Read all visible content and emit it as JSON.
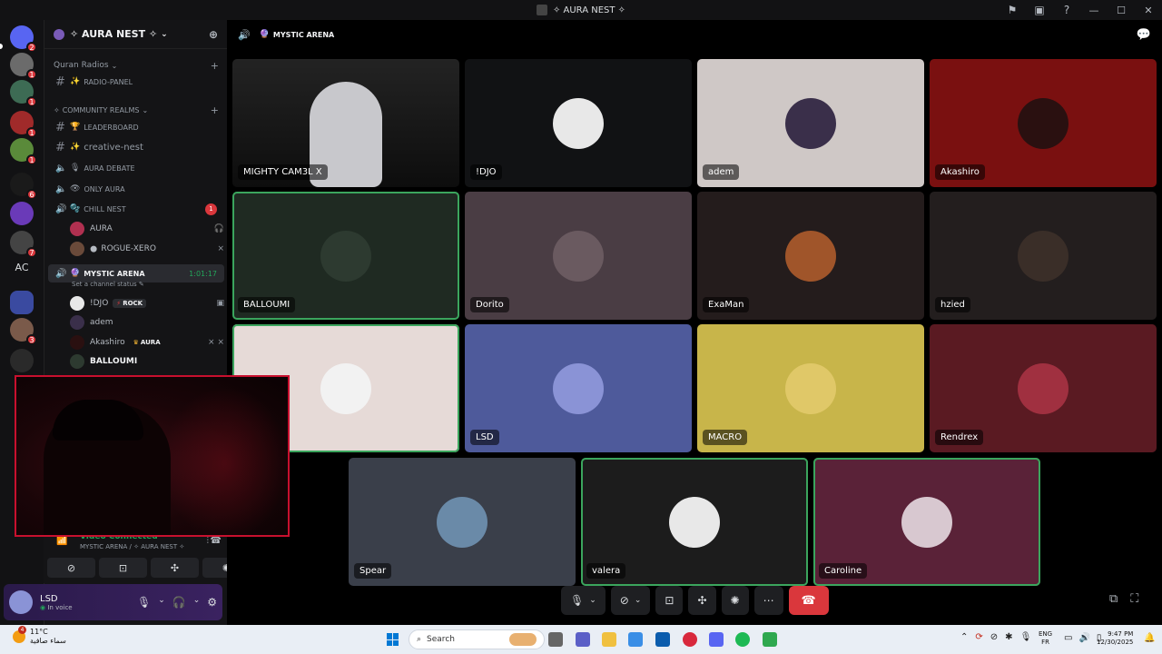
{
  "window": {
    "title": "✧ AURA NEST ✧"
  },
  "rail": {
    "servers": [
      {
        "name": "discord-home",
        "badge": "2",
        "color": "#5865f2"
      },
      {
        "name": "server-1",
        "badge": "1",
        "color": "#6b6b6b"
      },
      {
        "name": "server-2",
        "badge": "1",
        "color": "#3d6b54"
      },
      {
        "name": "server-3",
        "badge": "1",
        "color": "#a02a2a"
      },
      {
        "name": "server-4",
        "badge": "1",
        "color": "#5a8a3a"
      },
      {
        "name": "server-5",
        "badge": "6",
        "color": "#1a1a1a"
      },
      {
        "name": "server-6",
        "badge": "",
        "color": "#6a3ab8"
      },
      {
        "name": "server-7",
        "badge": "7",
        "color": "#444"
      },
      {
        "name": "server-folder",
        "badge": "",
        "color": "#3a4aa0"
      },
      {
        "name": "server-8",
        "badge": "3",
        "color": "#7a5a4a"
      },
      {
        "name": "server-9",
        "badge": "",
        "color": "#2a2a2a"
      }
    ],
    "ac_label": "AC"
  },
  "sidebar": {
    "server_name": "✧ AURA NEST ✧",
    "category_quran": "Quran Radios",
    "category_realms": "COMMUNITY REALMS",
    "channels": {
      "radio_panel": "RADIO-PANEL",
      "leaderboard": "LEADERBOARD",
      "creative_nest": "creative-nest",
      "aura_debate": "AURA DEBATE",
      "only_aura": "ONLY AURA",
      "chill_nest": "CHILL NEST",
      "chill_nest_count": "1",
      "mystic_arena": "MYSTIC ARENA",
      "mystic_arena_timer": "1:01:17",
      "channel_status": "Set a channel status"
    },
    "chill_users": [
      "AURA",
      "ROGUE-XERO"
    ],
    "mystic_users": [
      {
        "name": "!DJO",
        "tag": "ROCK"
      },
      {
        "name": "adem",
        "tag": ""
      },
      {
        "name": "Akashiro",
        "tag": "AURA"
      },
      {
        "name": "BALLOUMI",
        "tag": ""
      }
    ]
  },
  "voice_panel": {
    "status": "Video Connected",
    "location": "MYSTIC ARENA / ✧ AURA NEST ✧"
  },
  "user_panel": {
    "name": "LSD",
    "status": "In voice"
  },
  "main": {
    "channel_name": "MYSTIC ARENA",
    "tiles": [
      {
        "name": "MIGHTY CAM3L X",
        "bg": "#1a1a1a",
        "avatar": "#444",
        "speaking": false
      },
      {
        "name": "!DJO",
        "bg": "#111214",
        "avatar": "#e8e8e8",
        "speaking": false
      },
      {
        "name": "adem",
        "bg": "#cfc8c6",
        "avatar": "#3a2f4a",
        "speaking": false
      },
      {
        "name": "Akashiro",
        "bg": "#7a1010",
        "avatar": "#2a1010",
        "speaking": false
      },
      {
        "name": "BALLOUMI",
        "bg": "#1f2a22",
        "avatar": "#2d3a30",
        "speaking": true
      },
      {
        "name": "Dorito",
        "bg": "#4a3d44",
        "avatar": "#6a5a60",
        "speaking": false
      },
      {
        "name": "ExaMan",
        "bg": "#241c1c",
        "avatar": "#a0552a",
        "speaking": false
      },
      {
        "name": "hzied",
        "bg": "#231e1e",
        "avatar": "#3a2e28",
        "speaking": false
      },
      {
        "name": "",
        "bg": "#e6dad7",
        "avatar": "#f2f2f2",
        "speaking": true
      },
      {
        "name": "LSD",
        "bg": "#4e5a9b",
        "avatar": "#8a93d6",
        "speaking": false
      },
      {
        "name": "MACRO",
        "bg": "#c8b54a",
        "avatar": "#e0c868",
        "speaking": false
      },
      {
        "name": "Rendrex",
        "bg": "#5a1a22",
        "avatar": "#a03040",
        "speaking": false
      },
      {
        "name": "Spear",
        "bg": "#3a3f4a",
        "avatar": "#6a8aa8",
        "speaking": false
      },
      {
        "name": "valera",
        "bg": "#1c1c1c",
        "avatar": "#e8e8e8",
        "speaking": true
      },
      {
        "name": "Caroline",
        "bg": "#5a2238",
        "avatar": "#d8c8d0",
        "speaking": true
      }
    ]
  },
  "taskbar": {
    "weather_temp": "11°C",
    "weather_desc": "سماء صافية",
    "weather_badge": "4",
    "search_placeholder": "Search",
    "lang_top": "ENG",
    "lang_bottom": "FR",
    "time": "9:47 PM",
    "date": "12/30/2025"
  }
}
